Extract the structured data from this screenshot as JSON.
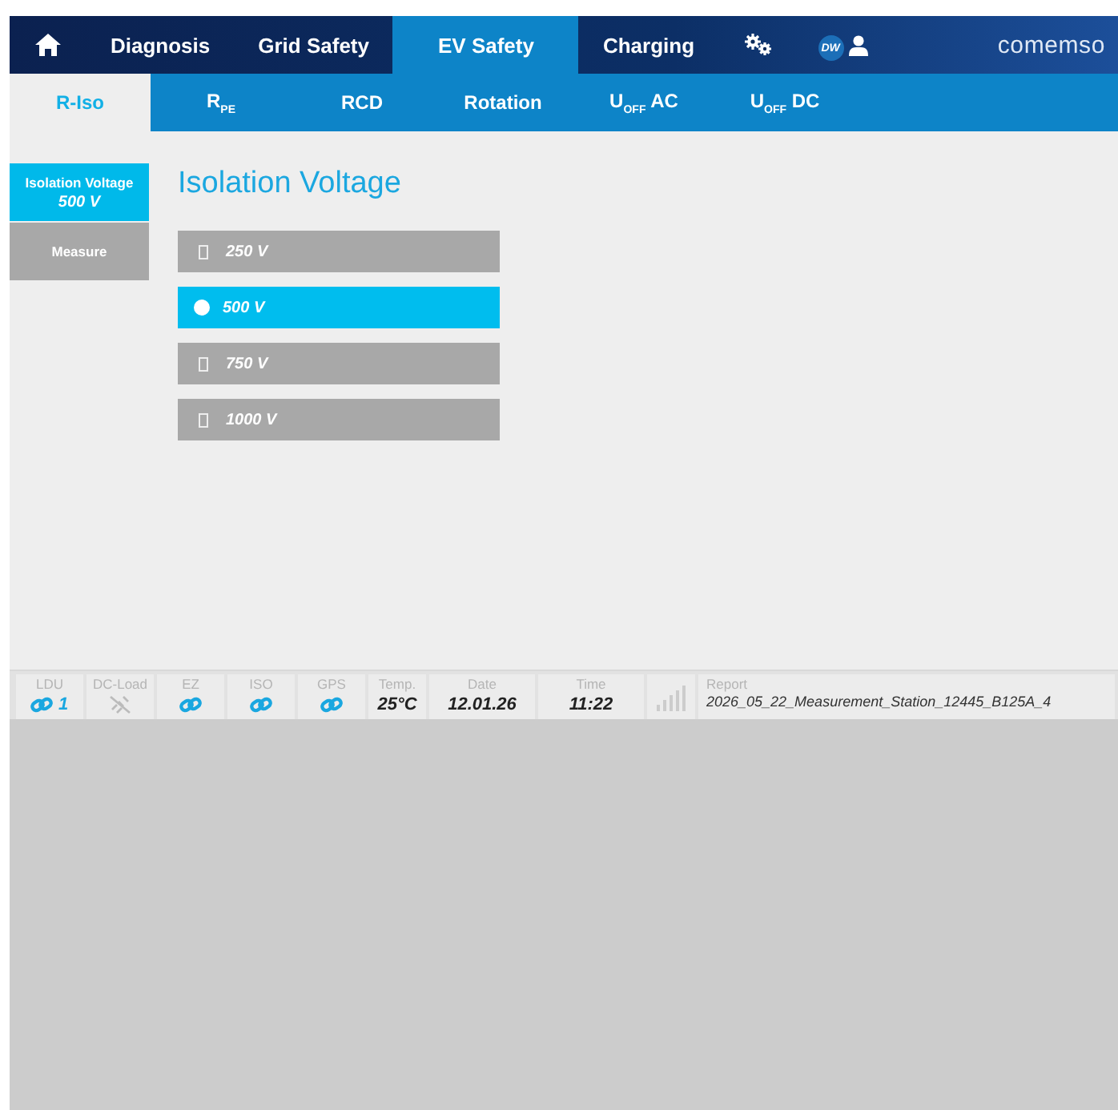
{
  "nav": {
    "tabs": [
      {
        "kind": "home",
        "selected": false
      },
      {
        "kind": "text",
        "label": "Diagnosis",
        "selected": false
      },
      {
        "kind": "text",
        "label": "Grid Safety",
        "selected": false
      },
      {
        "kind": "text",
        "label": "EV Safety",
        "selected": true
      },
      {
        "kind": "text",
        "label": "Charging",
        "selected": false
      },
      {
        "kind": "settings",
        "selected": false
      },
      {
        "kind": "user",
        "label": "DW",
        "selected": false
      }
    ],
    "logo": "comemso"
  },
  "subtabs": [
    {
      "label": "R-Iso",
      "selected": true
    },
    {
      "label": "R$_{PE}$",
      "selected": false
    },
    {
      "label": "RCD",
      "selected": false
    },
    {
      "label": "Rotation",
      "selected": false
    },
    {
      "label": "U$_{OFF}$ AC",
      "selected": false
    },
    {
      "label": "U$_{OFF}$ DC",
      "selected": false
    }
  ],
  "side_menu": [
    {
      "label": "Isolation Voltage",
      "value": "500 V",
      "selected": true
    },
    {
      "label": "Measure",
      "selected": false
    }
  ],
  "title": "Isolation Voltage",
  "options": [
    {
      "label": "250 V",
      "selected": false
    },
    {
      "label": "500 V",
      "selected": true
    },
    {
      "label": "750 V",
      "selected": false
    },
    {
      "label": "1000 V",
      "selected": false
    }
  ],
  "status_bar": [
    {
      "kind": "link",
      "label": "LDU",
      "connected": true,
      "value": "1"
    },
    {
      "kind": "link",
      "label": "DC-Load",
      "connected": false
    },
    {
      "kind": "link",
      "label": "EZ",
      "connected": true
    },
    {
      "kind": "link",
      "label": "ISO",
      "connected": true
    },
    {
      "kind": "link",
      "label": "GPS",
      "connected": true
    },
    {
      "kind": "text",
      "label": "Temp.",
      "value": "25°C"
    },
    {
      "kind": "text",
      "label": "Date",
      "value": "12.01.26"
    },
    {
      "kind": "text",
      "label": "Time",
      "value": "11:22"
    },
    {
      "kind": "signal"
    },
    {
      "kind": "report",
      "label": "Report",
      "value": "2026_05_22_Measurement_Station_12445_B125A_4"
    }
  ]
}
